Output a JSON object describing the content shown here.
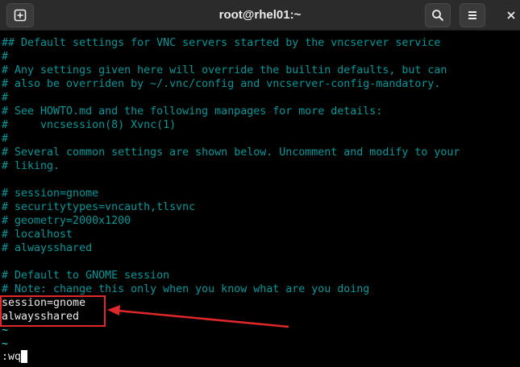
{
  "window": {
    "title": "root@rhel01:~"
  },
  "toolbar": {
    "new_tab_icon": "new-tab-icon",
    "search_icon": "search-icon",
    "menu_icon": "hamburger-menu-icon",
    "close_icon": "close-icon"
  },
  "terminal": {
    "lines": [
      "## Default settings for VNC servers started by the vncserver service",
      "#",
      "# Any settings given here will override the builtin defaults, but can",
      "# also be overriden by ~/.vnc/config and vncserver-config-mandatory.",
      "#",
      "# See HOWTO.md and the following manpages for more details:",
      "#     vncsession(8) Xvnc(1)",
      "#",
      "# Several common settings are shown below. Uncomment and modify to your",
      "# liking.",
      "",
      "# session=gnome",
      "# securitytypes=vncauth,tlsvnc",
      "# geometry=2000x1200",
      "# localhost",
      "# alwaysshared",
      "",
      "# Default to GNOME session",
      "# Note: change this only when you know what are you doing",
      "session=gnome",
      "alwaysshared",
      "~",
      "~",
      ":wq"
    ]
  },
  "colors": {
    "comment": "#06989a",
    "text": "#ececec",
    "tilde": "#34e2e2",
    "annotation": "#e0282a",
    "titlebar": "#2b2b2b"
  }
}
